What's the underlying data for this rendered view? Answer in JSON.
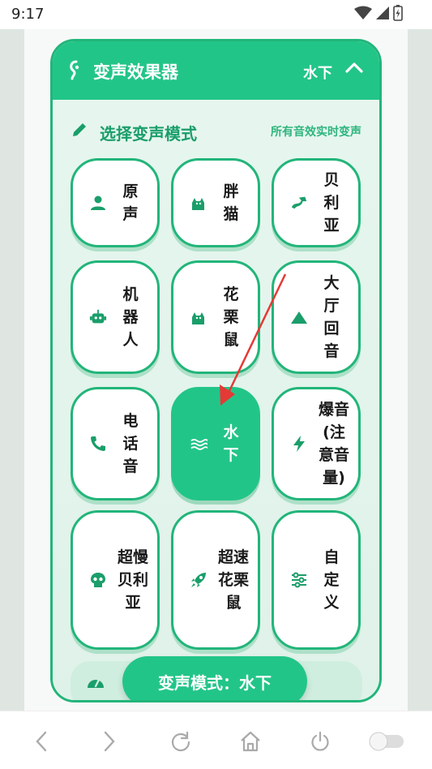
{
  "status_bar": {
    "time": "9:17"
  },
  "header": {
    "title": "变声效果器",
    "current_mode": "水下"
  },
  "section": {
    "title": "选择变声模式",
    "note": "所有音效实时变声"
  },
  "modes": [
    {
      "label": "原声",
      "icon": "person-icon"
    },
    {
      "label": "胖猫",
      "icon": "cat-icon"
    },
    {
      "label": "贝利亚",
      "icon": "dragon-icon"
    },
    {
      "label": "机器人",
      "icon": "robot-icon"
    },
    {
      "label": "花栗鼠",
      "icon": "cat-icon"
    },
    {
      "label": "大厅回音",
      "icon": "mountain-icon"
    },
    {
      "label": "电话音",
      "icon": "phone-icon"
    },
    {
      "label": "水下",
      "icon": "water-icon",
      "selected": true
    },
    {
      "label": "爆音(注意音量)",
      "icon": "bolt-icon"
    },
    {
      "label": "超慢贝利亚",
      "icon": "skull-icon"
    },
    {
      "label": "超速花栗鼠",
      "icon": "rocket-icon"
    },
    {
      "label": "自定义",
      "icon": "sliders-icon"
    }
  ],
  "bottom_pill": {
    "text": "变声模式：水下"
  },
  "colors": {
    "accent": "#22c588",
    "border": "#22b57a",
    "arrow": "#e53935"
  }
}
